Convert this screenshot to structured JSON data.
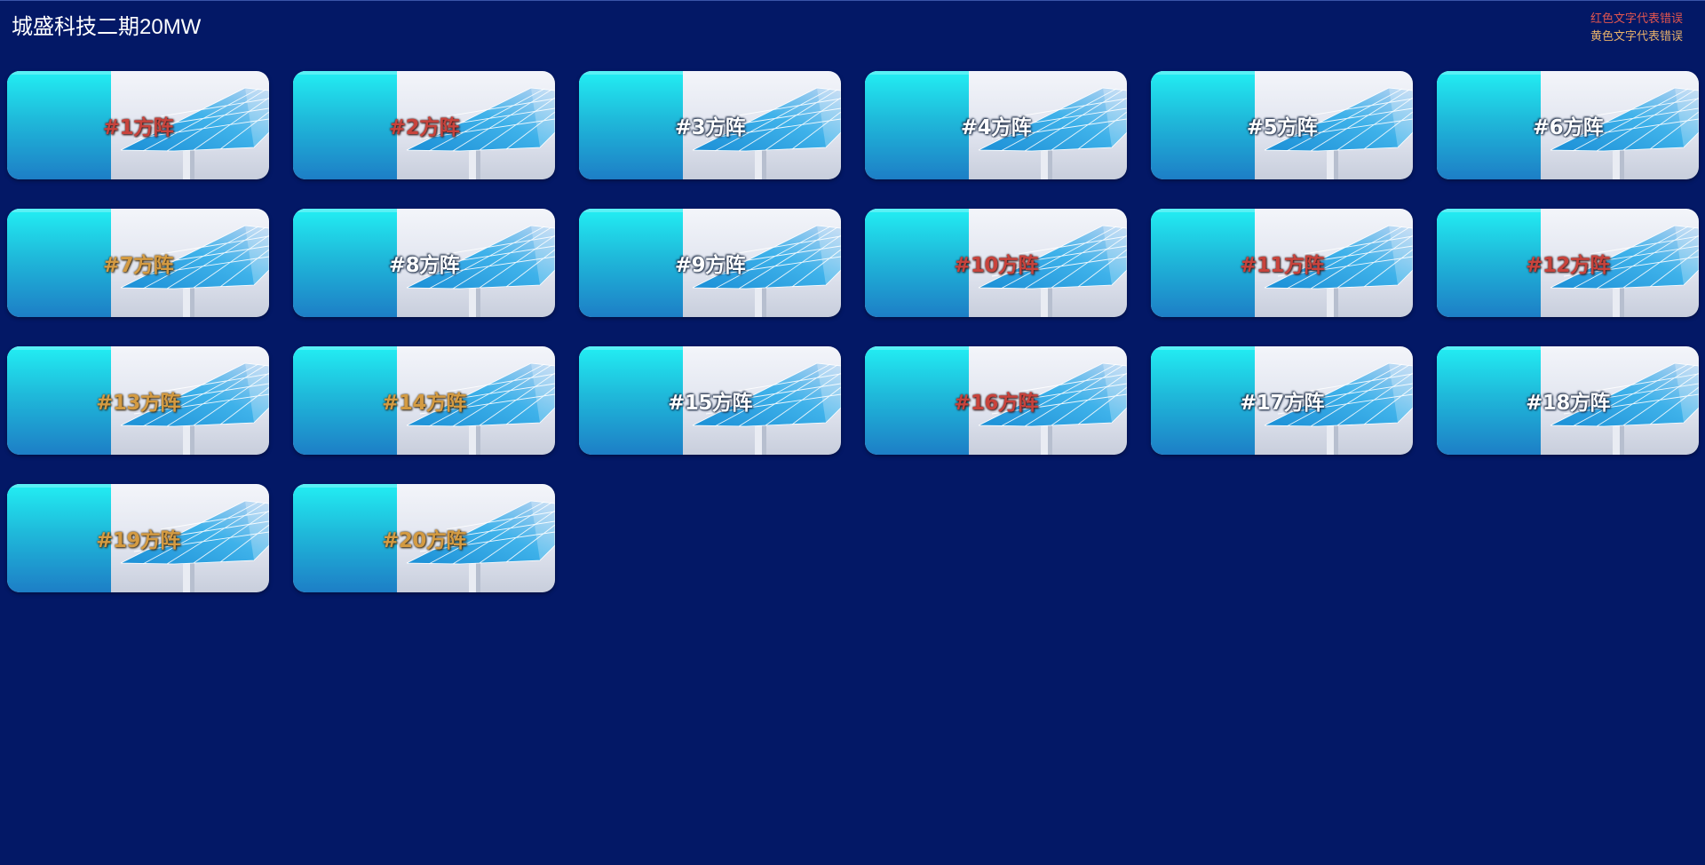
{
  "header": {
    "title": "城盛科技二期20MW"
  },
  "legend": {
    "red_text": "红色文字代表错误",
    "yellow_text": "黄色文字代表错误"
  },
  "colors": {
    "background": "#031866",
    "error": "#c8433c",
    "warning": "#d49b42",
    "normal": "#ffffff",
    "card_accent": "#22eef3"
  },
  "icon": "solar-panel-icon",
  "arrays": [
    {
      "label": "#1方阵",
      "status": "error"
    },
    {
      "label": "#2方阵",
      "status": "error"
    },
    {
      "label": "#3方阵",
      "status": "ok"
    },
    {
      "label": "#4方阵",
      "status": "ok"
    },
    {
      "label": "#5方阵",
      "status": "ok"
    },
    {
      "label": "#6方阵",
      "status": "ok"
    },
    {
      "label": "#7方阵",
      "status": "warn"
    },
    {
      "label": "#8方阵",
      "status": "ok"
    },
    {
      "label": "#9方阵",
      "status": "ok"
    },
    {
      "label": "#10方阵",
      "status": "error"
    },
    {
      "label": "#11方阵",
      "status": "error"
    },
    {
      "label": "#12方阵",
      "status": "error"
    },
    {
      "label": "#13方阵",
      "status": "warn"
    },
    {
      "label": "#14方阵",
      "status": "warn"
    },
    {
      "label": "#15方阵",
      "status": "ok"
    },
    {
      "label": "#16方阵",
      "status": "error"
    },
    {
      "label": "#17方阵",
      "status": "ok"
    },
    {
      "label": "#18方阵",
      "status": "ok"
    },
    {
      "label": "#19方阵",
      "status": "warn"
    },
    {
      "label": "#20方阵",
      "status": "warn"
    }
  ]
}
